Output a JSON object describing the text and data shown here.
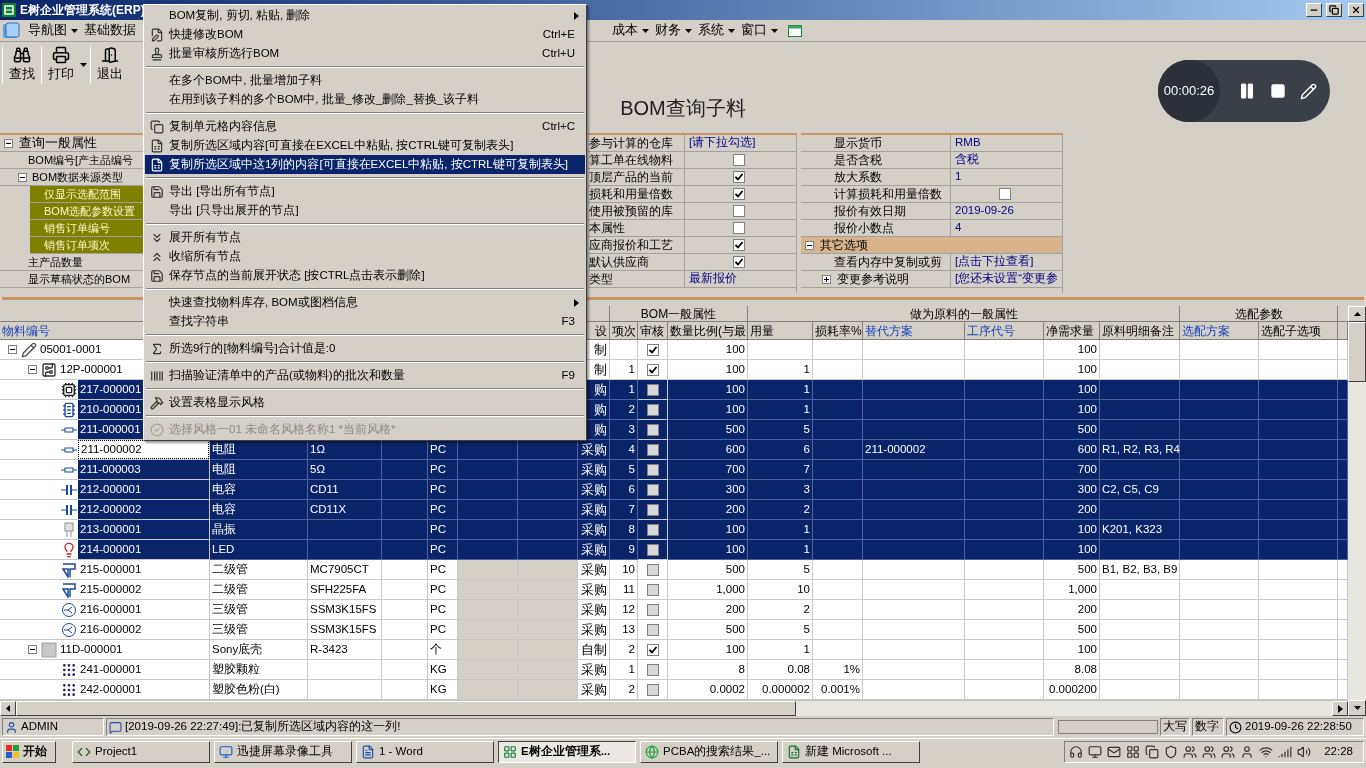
{
  "window": {
    "title": "E树企业管理系统(ERP)"
  },
  "menu_bar": [
    {
      "label": "导航图",
      "dropdown": true
    },
    {
      "label": "基础数据",
      "dropdown": false
    },
    {
      "label": "成本",
      "dropdown": true
    },
    {
      "label": "财务",
      "dropdown": true
    },
    {
      "label": "系统",
      "dropdown": true
    },
    {
      "label": "窗口",
      "dropdown": true
    }
  ],
  "toolbar": [
    {
      "label": "查找",
      "kind": "find"
    },
    {
      "label": "打印",
      "kind": "print"
    },
    {
      "label": "退出",
      "kind": "exit"
    }
  ],
  "page_title": "BOM查询子料",
  "recorder": {
    "time": "00:00:26"
  },
  "query_panel": {
    "section": {
      "label": "查询一般属性",
      "expanded": true
    },
    "rows": [
      {
        "label": "BOM编号[产主品编号",
        "highlighted": false
      },
      {
        "label": "BOM数据来源类型",
        "highlighted": false,
        "expanded": true,
        "children": [
          {
            "label": "仅显示选配范围",
            "highlighted": true
          },
          {
            "label": "BOM选配参数设置",
            "highlighted": true
          },
          {
            "label": "销售订单编号",
            "highlighted": true
          },
          {
            "label": "销售订单项次",
            "highlighted": true
          }
        ]
      },
      {
        "label": "主产品数量",
        "highlighted": false
      },
      {
        "label": "显示草稿状态的BOM",
        "highlighted": false
      }
    ]
  },
  "options_panel": {
    "rows": [
      {
        "label": "参与计算的仓库",
        "kind": "link",
        "value": "[请下拉勾选]"
      },
      {
        "label": "算工单在线物料",
        "kind": "check",
        "checked": false
      },
      {
        "label": "顶层产品的当前",
        "kind": "check",
        "checked": true
      },
      {
        "label": "损耗和用量倍数",
        "kind": "check",
        "checked": true
      },
      {
        "label": "使用被预留的库",
        "kind": "check",
        "checked": false
      },
      {
        "label": "本属性",
        "kind": "check",
        "checked": false
      },
      {
        "label": "应商报价和工艺",
        "kind": "check",
        "checked": true
      },
      {
        "label": "默认供应商",
        "kind": "check",
        "checked": true
      },
      {
        "label": "类型",
        "kind": "link",
        "value": "最新报价"
      }
    ]
  },
  "display_panel": {
    "rows": [
      {
        "label": "显示货币",
        "kind": "link",
        "value": "RMB"
      },
      {
        "label": "是否含税",
        "kind": "link",
        "value": "含税"
      },
      {
        "label": "放大系数",
        "kind": "link",
        "value": "1"
      },
      {
        "label": "计算损耗和用量倍数",
        "kind": "check",
        "checked": false
      },
      {
        "label": "报价有效日期",
        "kind": "link",
        "value": "2019-09-26"
      },
      {
        "label": "报价小数点",
        "kind": "link",
        "value": "4"
      },
      {
        "label": "其它选项",
        "kind": "section",
        "expanded": true
      },
      {
        "label": "查看内存中复制或剪",
        "kind": "link",
        "value": "[点击下拉查看]"
      },
      {
        "label": "变更参考说明",
        "kind": "group",
        "expanded": false,
        "value": "[您还未设置“变更参"
      }
    ]
  },
  "context_menu": {
    "groups": [
      [
        {
          "label": "BOM复制, 剪切, 粘贴, 删除",
          "submenu": true,
          "selected": false,
          "disabled": false
        },
        {
          "label": "快捷修改BOM",
          "shortcut": "Ctrl+E",
          "kind": "edit",
          "submenu": false,
          "selected": false,
          "disabled": false
        },
        {
          "label": "批量审核所选行BOM",
          "shortcut": "Ctrl+U",
          "kind": "approve",
          "submenu": false,
          "selected": false,
          "disabled": false
        }
      ],
      [
        {
          "label": "在多个BOM中, 批量增加子料",
          "submenu": false,
          "selected": false,
          "disabled": false
        },
        {
          "label": "在用到该子料的多个BOM中, 批量_修改_删除_替换_该子料",
          "submenu": false,
          "selected": false,
          "disabled": false
        }
      ],
      [
        {
          "label": "复制单元格内容信息",
          "shortcut": "Ctrl+C",
          "kind": "copy",
          "submenu": false,
          "selected": false,
          "disabled": false
        },
        {
          "label": "复制所选区域内容[可直接在EXCEL中粘贴, 按CTRL键可复制表头]",
          "kind": "copy-range",
          "submenu": false,
          "selected": false,
          "disabled": false
        },
        {
          "label": "复制所选区域中这1列的内容[可直接在EXCEL中粘贴, 按CTRL键可复制表头]",
          "kind": "copy-range",
          "submenu": false,
          "selected": true,
          "disabled": false
        }
      ],
      [
        {
          "label": "导出 [导出所有节点]",
          "kind": "save",
          "submenu": false,
          "selected": false,
          "disabled": false
        },
        {
          "label": "导出 [只导出展开的节点]",
          "submenu": false,
          "selected": false,
          "disabled": false
        }
      ],
      [
        {
          "label": "展开所有节点",
          "kind": "expand",
          "submenu": false,
          "selected": false,
          "disabled": false
        },
        {
          "label": "收缩所有节点",
          "kind": "collapse",
          "submenu": false,
          "selected": false,
          "disabled": false
        },
        {
          "label": "保存节点的当前展开状态 [按CTRL点击表示删除]",
          "kind": "save",
          "submenu": false,
          "selected": false,
          "disabled": false
        }
      ],
      [
        {
          "label": "快速查找物料库存, BOM或图档信息",
          "submenu": true,
          "selected": false,
          "disabled": false
        },
        {
          "label": "查找字符串",
          "shortcut": "F3",
          "submenu": false,
          "selected": false,
          "disabled": false
        }
      ],
      [
        {
          "label": "所选9行的[物料编号]合计值是:0",
          "kind": "sum",
          "submenu": false,
          "selected": false,
          "disabled": false
        }
      ],
      [
        {
          "label": "扫描验证清单中的产品(或物料)的批次和数量",
          "shortcut": "F9",
          "kind": "barcode",
          "submenu": false,
          "selected": false,
          "disabled": false
        }
      ],
      [
        {
          "label": "设置表格显示风格",
          "kind": "tools",
          "submenu": false,
          "selected": false,
          "disabled": false
        }
      ],
      [
        {
          "label": "选择风格一01  未命名风格名称1 *当前风格*",
          "kind": "check",
          "submenu": false,
          "selected": false,
          "disabled": true
        }
      ]
    ]
  },
  "table": {
    "group_headers": [
      {
        "label": "BOM一般属性"
      },
      {
        "label": "做为原料的一般属性"
      },
      {
        "label": "选配参数"
      }
    ],
    "columns": [
      {
        "label": "物料编号",
        "link": true
      },
      {
        "label": "设",
        "link": false
      },
      {
        "label": "项次",
        "link": false
      },
      {
        "label": "审核",
        "link": false
      },
      {
        "label": "数量比例(与最",
        "link": false
      },
      {
        "label": "用量",
        "link": false
      },
      {
        "label": "损耗率%",
        "link": false
      },
      {
        "label": "替代方案",
        "link": true
      },
      {
        "label": "工序代号",
        "link": true
      },
      {
        "label": "净需求量",
        "link": false
      },
      {
        "label": "原料明细备注",
        "link": false
      },
      {
        "label": "选配方案",
        "link": true
      },
      {
        "label": "选配子选项",
        "link": false
      }
    ],
    "rows": [
      {
        "code": "05001-0001",
        "kind": "pen",
        "source": "制",
        "approved": true,
        "ratio": "100",
        "net": "100",
        "selected": false,
        "focused": false,
        "expanded": true,
        "children": [
          {
            "code": "12P-000001",
            "kind": "board",
            "source": "制",
            "seq": "1",
            "approved": true,
            "ratio": "100",
            "qty": "1",
            "net": "100",
            "selected": false,
            "focused": false,
            "expanded": true,
            "children": [
              {
                "code": "217-000001",
                "kind": "chip",
                "source": "购",
                "seq": "1",
                "approved": false,
                "ratio": "100",
                "qty": "1",
                "net": "100",
                "selected": true,
                "focused": false
              },
              {
                "code": "210-000001",
                "kind": "ic",
                "source": "购",
                "seq": "2",
                "approved": false,
                "ratio": "100",
                "qty": "1",
                "net": "100",
                "selected": true,
                "focused": false
              },
              {
                "code": "211-000001",
                "kind": "resistor",
                "source": "购",
                "seq": "3",
                "approved": false,
                "ratio": "500",
                "qty": "5",
                "net": "500",
                "selected": true,
                "focused": false
              },
              {
                "code": "211-000002",
                "kind": "resistor",
                "name": "电阻",
                "spec": "1Ω",
                "unit": "PC",
                "source": "采购",
                "seq": "4",
                "approved": false,
                "ratio": "600",
                "qty": "6",
                "alt": "211-000002",
                "net": "600",
                "note": "R1, R2, R3, R4",
                "selected": true,
                "focused": true
              },
              {
                "code": "211-000003",
                "kind": "resistor",
                "name": "电阻",
                "spec": "5Ω",
                "unit": "PC",
                "source": "采购",
                "seq": "5",
                "approved": false,
                "ratio": "700",
                "qty": "7",
                "net": "700",
                "selected": true,
                "focused": false
              },
              {
                "code": "212-000001",
                "kind": "capacitor",
                "name": "电容",
                "spec": "CD11",
                "unit": "PC",
                "source": "采购",
                "seq": "6",
                "approved": false,
                "ratio": "300",
                "qty": "3",
                "net": "300",
                "note": "C2, C5, C9",
                "selected": true,
                "focused": false
              },
              {
                "code": "212-000002",
                "kind": "capacitor",
                "name": "电容",
                "spec": "CD11X",
                "unit": "PC",
                "source": "采购",
                "seq": "7",
                "approved": false,
                "ratio": "200",
                "qty": "2",
                "net": "200",
                "selected": true,
                "focused": false
              },
              {
                "code": "213-000001",
                "kind": "crystal",
                "name": "晶振",
                "unit": "PC",
                "source": "采购",
                "seq": "8",
                "approved": false,
                "ratio": "100",
                "qty": "1",
                "net": "100",
                "note": "K201, K323",
                "selected": true,
                "focused": false
              },
              {
                "code": "214-000001",
                "kind": "led",
                "name": "LED",
                "unit": "PC",
                "source": "采购",
                "seq": "9",
                "approved": false,
                "ratio": "100",
                "qty": "1",
                "net": "100",
                "selected": true,
                "focused": false
              },
              {
                "code": "215-000001",
                "kind": "diode",
                "name": "二级管",
                "spec": "MC7905CT",
                "unit": "PC",
                "source": "采购",
                "seq": "10",
                "approved": false,
                "ratio": "500",
                "qty": "5",
                "net": "500",
                "note": "B1, B2, B3, B9",
                "selected": false,
                "focused": false
              },
              {
                "code": "215-000002",
                "kind": "diode",
                "name": "二级管",
                "spec": "SFH225FA",
                "unit": "PC",
                "source": "采购",
                "seq": "11",
                "approved": false,
                "ratio": "1,000",
                "qty": "10",
                "net": "1,000",
                "selected": false,
                "focused": false
              },
              {
                "code": "216-000001",
                "kind": "transistor",
                "name": "三级管",
                "spec": "SSM3K15FS",
                "unit": "PC",
                "source": "采购",
                "seq": "12",
                "approved": false,
                "ratio": "200",
                "qty": "2",
                "net": "200",
                "selected": false,
                "focused": false
              },
              {
                "code": "216-000002",
                "kind": "transistor",
                "name": "三级管",
                "spec": "SSM3K15FS",
                "unit": "PC",
                "source": "采购",
                "seq": "13",
                "approved": false,
                "ratio": "500",
                "qty": "5",
                "net": "500",
                "selected": false,
                "focused": false
              }
            ]
          },
          {
            "code": "11D-000001",
            "kind": "case",
            "name": "Sony底壳",
            "spec": "R-3423",
            "unit": "个",
            "source": "自制",
            "seq": "2",
            "approved": true,
            "ratio": "100",
            "qty": "1",
            "net": "100",
            "selected": false,
            "focused": false,
            "expanded": true,
            "children": [
              {
                "code": "241-000001",
                "kind": "pellets",
                "name": "塑胶颗粒",
                "unit": "KG",
                "source": "采购",
                "seq": "1",
                "approved": false,
                "ratio": "8",
                "qty": "0.08",
                "loss": "1%",
                "net": "8.08",
                "selected": false,
                "focused": false
              },
              {
                "code": "242-000001",
                "kind": "pellets",
                "name": "塑胶色粉(白)",
                "unit": "KG",
                "source": "采购",
                "seq": "2",
                "approved": false,
                "ratio": "0.0002",
                "qty": "0.000002",
                "loss": "0.001%",
                "net": "0.000200",
                "selected": false,
                "focused": false
              }
            ]
          }
        ]
      }
    ]
  },
  "status_bar": {
    "user": "ADMIN",
    "message": "[2019-09-26 22:27:49]:已复制所选区域内容的这一列!",
    "caps": "大写",
    "num": "数字",
    "datetime": "2019-09-26 22:28:50"
  },
  "taskbar": {
    "start": "开始",
    "clock": "22:28",
    "tasks": [
      {
        "label": "Project1",
        "kind": "vb",
        "selected": false
      },
      {
        "label": "迅捷屏幕录像工具",
        "kind": "recorder",
        "selected": false
      },
      {
        "label": "1 - Word",
        "kind": "word",
        "selected": false
      },
      {
        "label": "E树企业管理系...",
        "kind": "erp",
        "selected": true
      },
      {
        "label": "PCBA的搜索结果_...",
        "kind": "browser",
        "selected": false
      },
      {
        "label": "新建 Microsoft ...",
        "kind": "excel",
        "selected": false
      }
    ]
  }
}
